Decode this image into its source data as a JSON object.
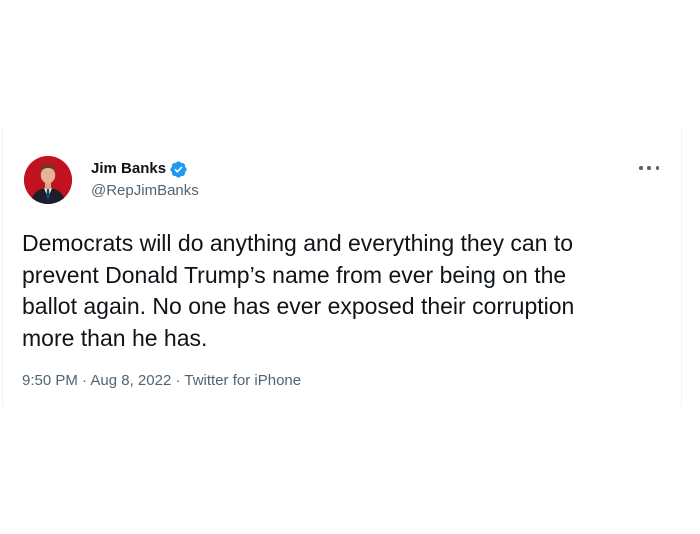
{
  "tweet": {
    "author": {
      "display_name": "Jim Banks",
      "handle": "@RepJimBanks",
      "verified": true,
      "avatar_icon": "profile-photo-avatar",
      "verified_icon": "verified-badge-icon"
    },
    "text": "Democrats will do anything and everything they can to\nprevent Donald Trump’s name from ever being on the\nballot again. No one has ever exposed their corruption\nmore than he has.",
    "time": "9:50 PM",
    "separator": "·",
    "date": "Aug 8, 2022",
    "source": "Twitter for iPhone",
    "more_icon": "more-options-icon"
  },
  "colors": {
    "text_primary": "#0f1419",
    "text_secondary": "#536471",
    "verified_blue": "#1d9bf0",
    "avatar_background": "#c1121f"
  }
}
